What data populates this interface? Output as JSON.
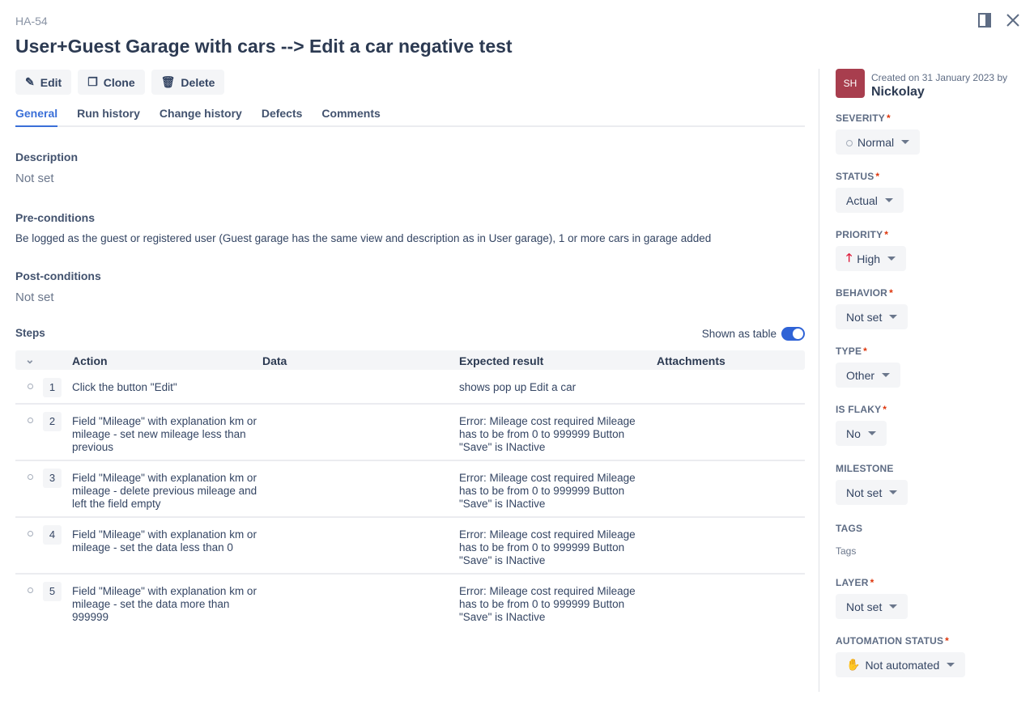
{
  "header": {
    "key": "HA-54",
    "title": "User+Guest Garage with cars --> Edit a car negative test"
  },
  "toolbar": {
    "edit": "Edit",
    "clone": "Clone",
    "delete": "Delete"
  },
  "tabs": [
    "General",
    "Run history",
    "Change history",
    "Defects",
    "Comments"
  ],
  "description": {
    "label": "Description",
    "value": "Not set"
  },
  "preconditions": {
    "label": "Pre-conditions",
    "value": "Be logged as the guest or registered user (Guest garage has the same view and description as in User garage), 1 or more cars in garage added"
  },
  "postconditions": {
    "label": "Post-conditions",
    "value": "Not set"
  },
  "steps": {
    "label": "Steps",
    "toggle_label": "Shown as table",
    "toggle_on": true,
    "columns": [
      "Action",
      "Data",
      "Expected result",
      "Attachments"
    ],
    "rows": [
      {
        "n": "1",
        "action": "Click the button \"Edit\"",
        "data": "",
        "expected": "shows pop up Edit a car"
      },
      {
        "n": "2",
        "action": "Field \"Mileage\" with explanation km or mileage - set new mileage less than previous",
        "data": "",
        "expected": "Error: Mileage cost required Mileage has to be from 0 to 999999 Button \"Save\" is INactive"
      },
      {
        "n": "3",
        "action": "Field \"Mileage\" with explanation km or mileage - delete previous mileage and left the field empty",
        "data": "",
        "expected": "Error: Mileage cost required Mileage has to be from 0 to 999999 Button \"Save\" is INactive"
      },
      {
        "n": "4",
        "action": "Field \"Mileage\" with explanation km or mileage - set the data less than 0",
        "data": "",
        "expected": "Error: Mileage cost required Mileage has to be from 0 to 999999 Button \"Save\" is INactive"
      },
      {
        "n": "5",
        "action": "Field \"Mileage\" with explanation km or mileage - set the data more than 999999",
        "data": "",
        "expected": "Error: Mileage cost required Mileage has to be from 0 to 999999 Button \"Save\" is INactive"
      }
    ]
  },
  "sidebar": {
    "avatar_initials": "SH",
    "avatar_color": "#a83e4e",
    "created_text": "Created on 31 January 2023 by",
    "author": "Nickolay",
    "fields": [
      {
        "label": "SEVERITY",
        "required": true,
        "value": "Normal",
        "icon": "circle-icon"
      },
      {
        "label": "STATUS",
        "required": true,
        "value": "Actual"
      },
      {
        "label": "PRIORITY",
        "required": true,
        "value": "High",
        "icon": "arrow-up-icon"
      },
      {
        "label": "BEHAVIOR",
        "required": true,
        "value": "Not set"
      },
      {
        "label": "TYPE",
        "required": true,
        "value": "Other"
      },
      {
        "label": "IS FLAKY",
        "required": true,
        "value": "No"
      },
      {
        "label": "MILESTONE",
        "required": false,
        "value": "Not set"
      },
      {
        "label": "TAGS",
        "required": false,
        "placeholder": "Tags"
      },
      {
        "label": "LAYER",
        "required": true,
        "value": "Not set"
      },
      {
        "label": "AUTOMATION STATUS",
        "required": true,
        "value": "Not automated",
        "icon": "hand-icon"
      }
    ]
  }
}
